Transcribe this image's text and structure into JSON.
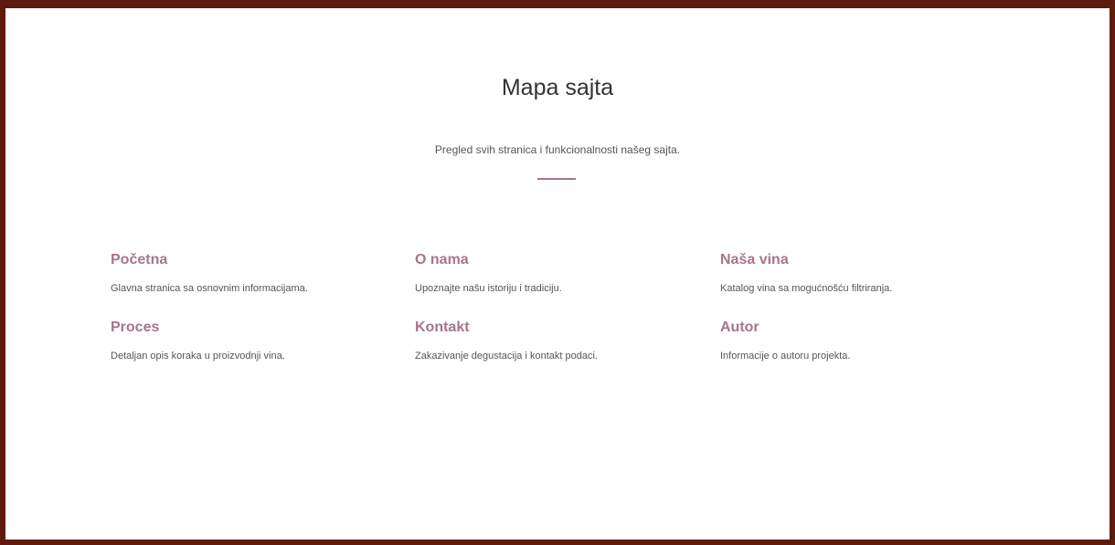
{
  "page": {
    "title": "Mapa sajta",
    "subtitle": "Pregled svih stranica i funkcionalnosti našeg sajta."
  },
  "sitemap": {
    "items": [
      {
        "title": "Početna",
        "description": "Glavna stranica sa osnovnim informacijama."
      },
      {
        "title": "O nama",
        "description": "Upoznajte našu istoriju i tradiciju."
      },
      {
        "title": "Naša vina",
        "description": "Katalog vina sa mogućnošću filtriranja."
      },
      {
        "title": "Proces",
        "description": "Detaljan opis koraka u proizvodnji vina."
      },
      {
        "title": "Kontakt",
        "description": "Zakazivanje degustacija i kontakt podaci."
      },
      {
        "title": "Autor",
        "description": "Informacije o autoru projekta."
      }
    ]
  },
  "colors": {
    "frame": "#5e1a0c",
    "accent": "#a8748c",
    "title_text": "#333333",
    "body_text": "#555555"
  }
}
